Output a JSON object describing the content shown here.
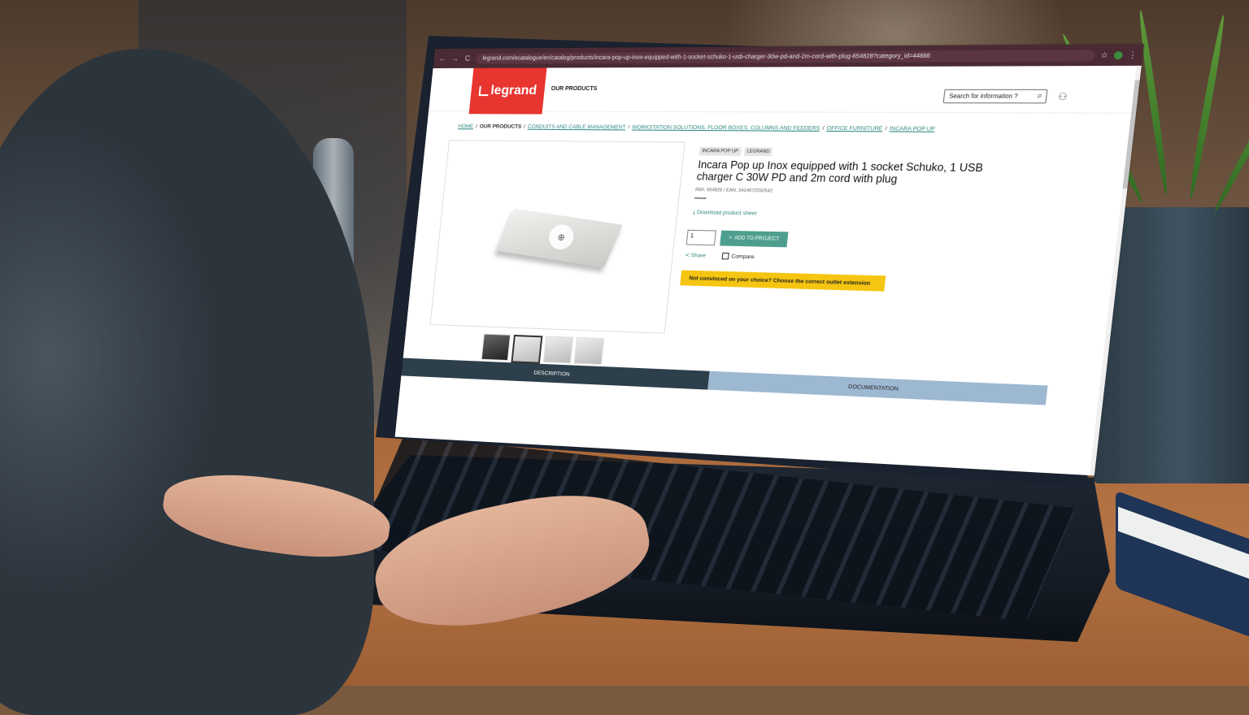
{
  "browser": {
    "url": "legrand.com/ecatalogue/en/catalog/products/incara-pop-up-inox-equipped-with-1-socket-schuko-1-usb-charger-30w-pd-and-2m-cord-with-plug-654828?category_id=44886",
    "back_icon": "←",
    "forward_icon": "→",
    "reload_icon": "C",
    "bookmark_icon": "☆",
    "menu_icon": "⋮"
  },
  "header": {
    "logo_text": "legrand",
    "nav_products": "OUR PRODUCTS",
    "search_placeholder": "Search for information ?",
    "search_icon": "⌕",
    "user_icon": "⚇"
  },
  "breadcrumb": [
    {
      "label": "HOME",
      "link": true
    },
    {
      "label": "OUR PRODUCTS",
      "link": false
    },
    {
      "label": "CONDUITS AND CABLE MANAGEMENT",
      "link": true
    },
    {
      "label": "WORKSTATION SOLUTIONS, FLOOR BOXES, COLUMNS AND FEEDERS",
      "link": true
    },
    {
      "label": "OFFICE FURNITURE",
      "link": true
    },
    {
      "label": "INCARA POP UP",
      "link": true
    }
  ],
  "product": {
    "tags": [
      "INCARA POP UP",
      "LEGRAND"
    ],
    "title": "Incara Pop up Inox equipped with 1 socket Schuko, 1 USB charger C 30W PD and 2m cord with plug",
    "ref": "REF. 654828",
    "ean": "EAN. 3414972292542",
    "download_label": "Download product sheet",
    "quantity": "1",
    "add_to_project": "ADD TO PROJECT",
    "share_label": "Share",
    "compare_label": "Compare",
    "banner_text": "Not convinced on your choice? Choose the correct outlet extension",
    "zoom_icon": "⊕"
  },
  "tabs": [
    {
      "label": "DESCRIPTION",
      "active": true
    },
    {
      "label": "DOCUMENTATION",
      "active": false
    }
  ],
  "colors": {
    "brand_red": "#e8352f",
    "accent_teal": "#4e9e8f",
    "banner_yellow": "#f5c511",
    "tab_dark": "#2d3f4a",
    "tab_light": "#9db8d1"
  }
}
